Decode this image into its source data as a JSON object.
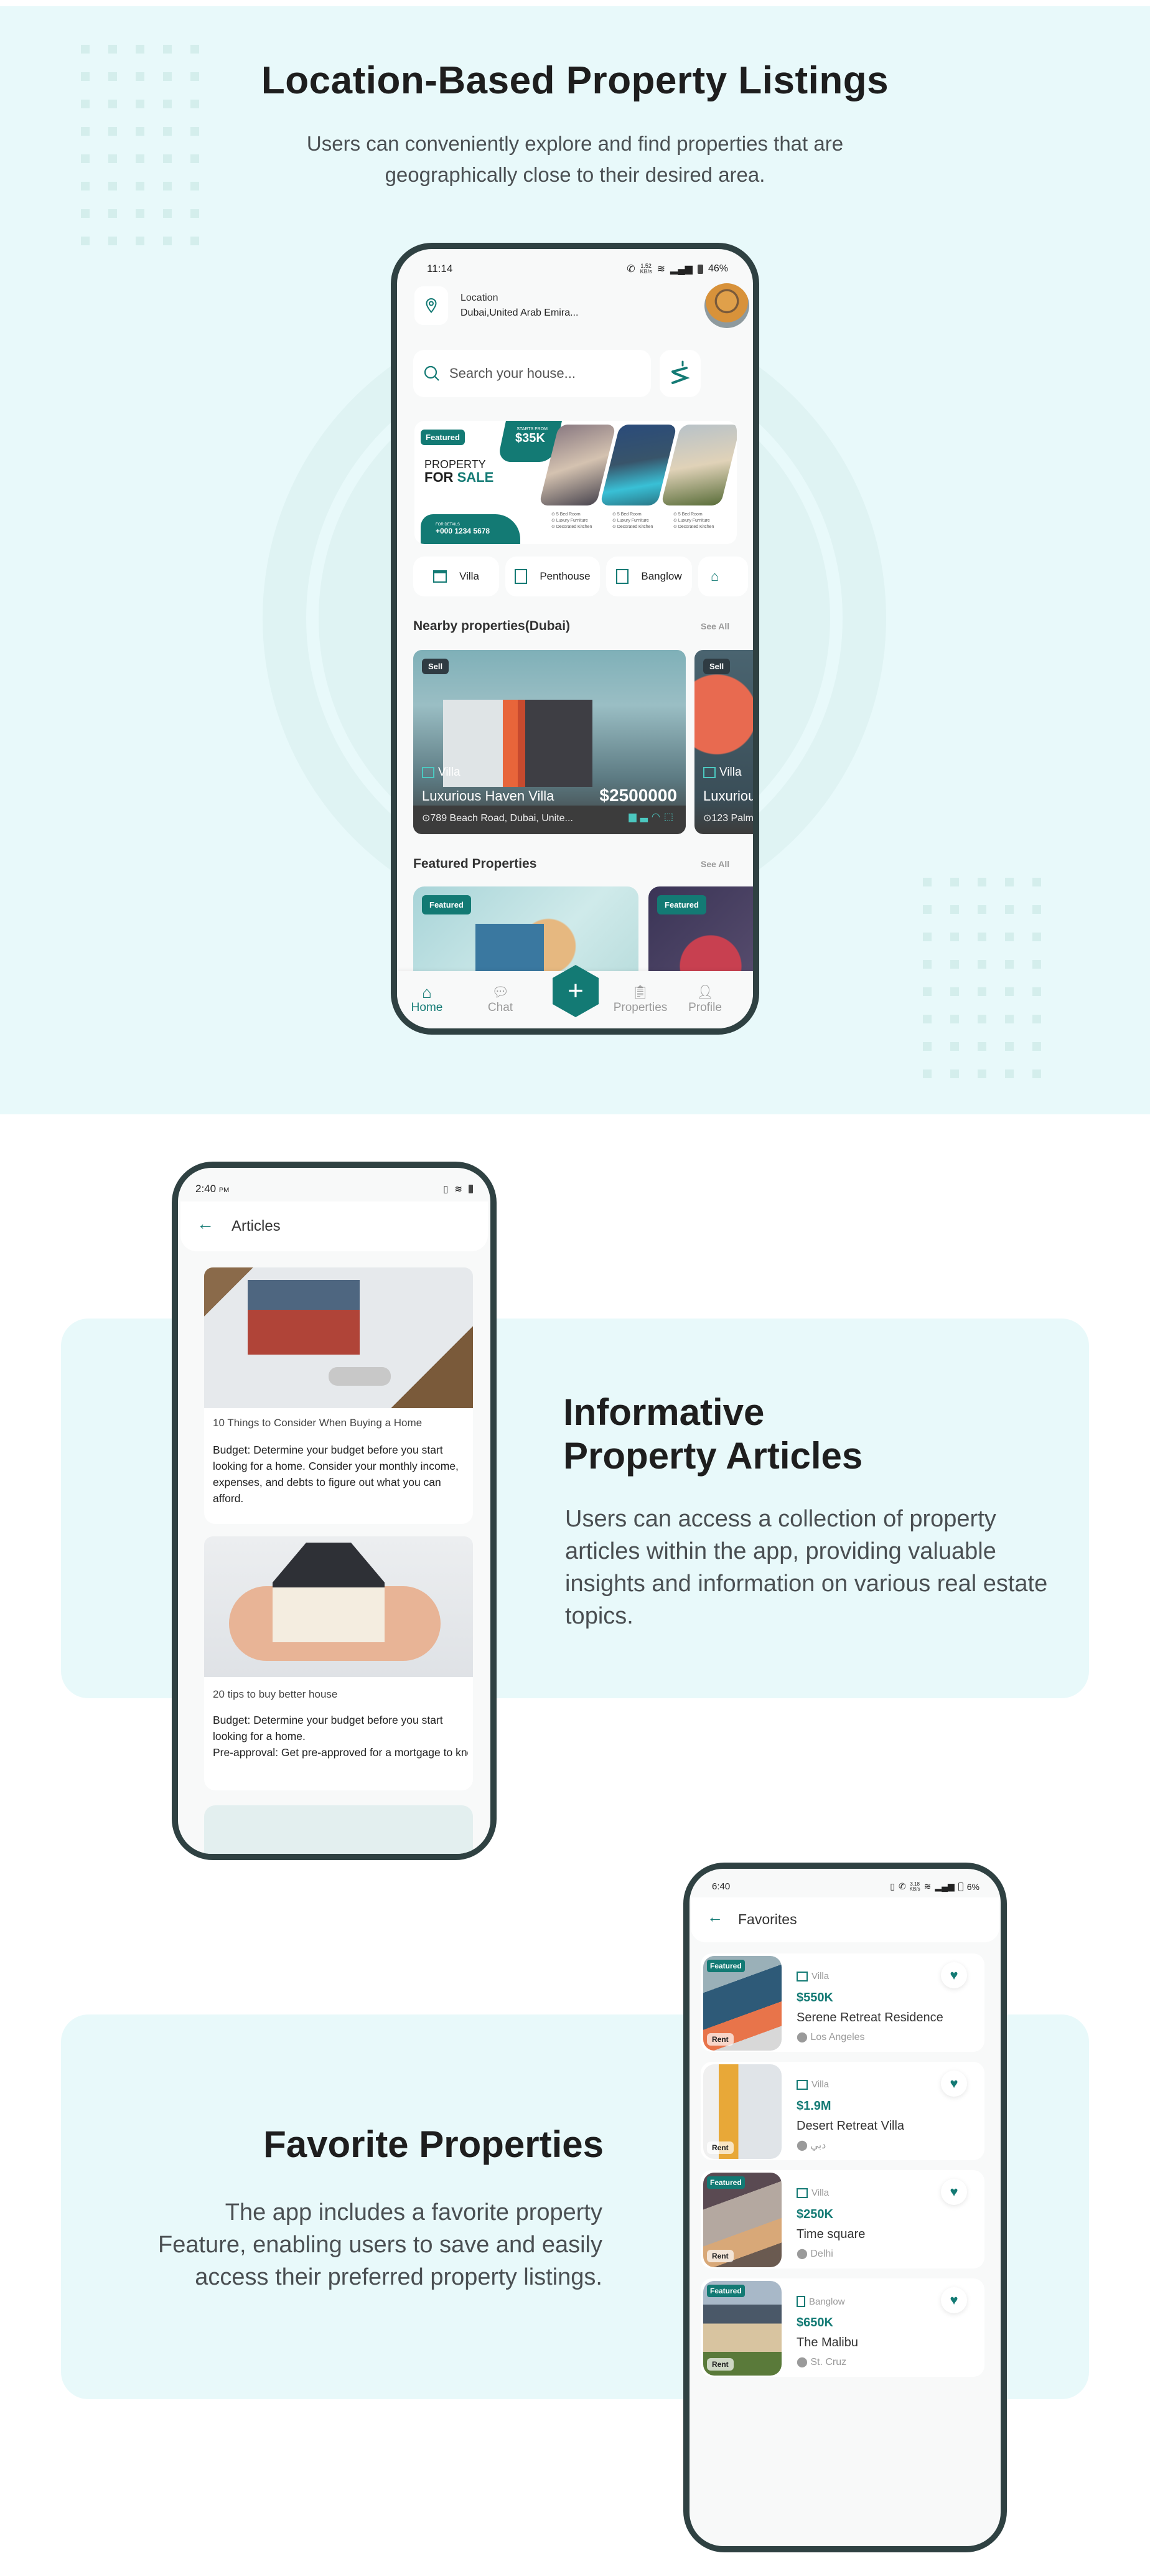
{
  "section_location": {
    "title": "Location-Based Property Listings",
    "description": "Users can conveniently explore and find properties that are geographically close to their desired area.",
    "phone": {
      "status": {
        "time": "11:14",
        "speed_value": "1.52",
        "speed_unit": "KB/s",
        "battery": "46%"
      },
      "location_label": "Location",
      "location_value": "Dubai,United Arab Emira...",
      "search_placeholder": "Search your house...",
      "banner": {
        "badge": "Featured",
        "starts_from_label": "STARTS FROM",
        "price": "$35K",
        "headline_line1": "PROPERTY",
        "headline_for": "FOR",
        "headline_sale": "SALE",
        "contact_label": "FOR DETAILS",
        "phone_number": "+000 1234 5678",
        "features": [
          "5 Bed Room",
          "Luxury Furniture",
          "Decorated Kitchen"
        ]
      },
      "categories": [
        {
          "label": "Villa",
          "icon": "villa-icon"
        },
        {
          "label": "Penthouse",
          "icon": "penthouse-icon"
        },
        {
          "label": "Banglow",
          "icon": "banglow-icon"
        },
        {
          "label": "",
          "icon": "house-icon"
        }
      ],
      "nearby": {
        "title": "Nearby properties(Dubai)",
        "see_all": "See All",
        "items": [
          {
            "badge": "Sell",
            "type": "Villa",
            "name": "Luxurious Haven Villa",
            "price": "$2500000",
            "address": "789 Beach Road, Dubai, Unite..."
          },
          {
            "badge": "Sell",
            "type": "Villa",
            "name": "Luxuriou",
            "price": "",
            "address": "123 Palm"
          }
        ]
      },
      "featured": {
        "title": "Featured Properties",
        "see_all": "See All",
        "items": [
          {
            "badge": "Featured"
          },
          {
            "badge": "Featured"
          }
        ]
      },
      "nav": [
        {
          "label": "Home",
          "icon": "home-icon",
          "active": true
        },
        {
          "label": "Chat",
          "icon": "chat-icon",
          "active": false
        },
        {
          "label": "",
          "icon": "plus-icon",
          "active": false
        },
        {
          "label": "Properties",
          "icon": "properties-icon",
          "active": false
        },
        {
          "label": "Profile",
          "icon": "profile-icon",
          "active": false
        }
      ]
    }
  },
  "section_articles": {
    "title_line1": "Informative",
    "title_line2": "Property Articles",
    "description": "Users can access a collection of property articles within the app, providing valuable insights and information on various real estate topics.",
    "phone": {
      "status": {
        "time": "2:40",
        "ampm": "PM"
      },
      "header_title": "Articles",
      "articles": [
        {
          "title": "10 Things to Consider When Buying a Home",
          "body": "Budget: Determine your budget before you start looking for a home. Consider your monthly income, expenses, and debts to figure out what you can afford."
        },
        {
          "title": "20 tips to buy better house",
          "body_line1": "Budget: Determine your budget before you start looking for a home.",
          "body_line2": "Pre-approval: Get pre-approved for a mortgage to know your maximum loan amo..."
        }
      ]
    }
  },
  "section_favorites": {
    "title": "Favorite Properties",
    "description_line1": "The app includes a favorite property",
    "description_line2": "Feature, enabling users to save and easily",
    "description_line3": "access their preferred property listings.",
    "phone": {
      "status": {
        "time": "6:40",
        "speed_value": "3.18",
        "speed_unit": "KB/s",
        "battery": "6%"
      },
      "header_title": "Favorites",
      "items": [
        {
          "featured": "Featured",
          "rent": "Rent",
          "type": "Villa",
          "price": "$550K",
          "name": "Serene Retreat Residence",
          "location": "Los Angeles"
        },
        {
          "featured": "",
          "rent": "Rent",
          "type": "Villa",
          "price": "$1.9M",
          "name": "Desert Retreat Villa",
          "location": "دبي"
        },
        {
          "featured": "Featured",
          "rent": "Rent",
          "type": "Villa",
          "price": "$250K",
          "name": "Time square",
          "location": "Delhi"
        },
        {
          "featured": "Featured",
          "rent": "Rent",
          "type": "Banglow",
          "price": "$650K",
          "name": "The Malibu",
          "location": "St. Cruz"
        }
      ]
    }
  },
  "colors": {
    "accent": "#137a74",
    "frame": "#2f4142",
    "band": "#e8f9fa",
    "heart": "#137a74"
  }
}
